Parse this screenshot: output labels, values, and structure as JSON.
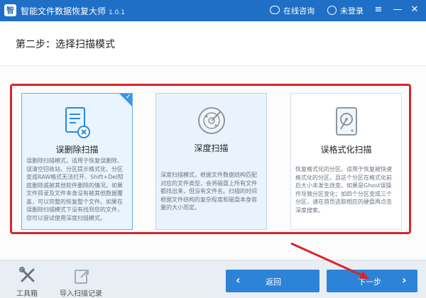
{
  "app": {
    "logo_glyph": "智",
    "title": "智能文件数据恢复大师",
    "version": "1.0.1",
    "online_consult": "在线咨询",
    "login": "未登录",
    "accent_color": "#1e6fc5",
    "highlight_color": "#d7262a"
  },
  "step": {
    "title": "第二步：选择扫描模式"
  },
  "modes": [
    {
      "title": "误删除扫描",
      "icon": "document-delete-icon",
      "selected": true,
      "description": "误删除扫描模式，适用于恢复误删除、误清空回收站、分区提示格式化、分区变成RAW格式无法打开、Shift+Del彻底删除或被其他软件删除的情况。如果文件目录及文件本身没有被其他数据覆盖，可以完整的恢复整个文件。如果在误删除扫描模式下没有找到您的文件，您可以尝试使用深度扫描模式。"
    },
    {
      "title": "深度扫描",
      "icon": "radar-icon",
      "selected": false,
      "description": "深度扫描模式，根据文件数据结构匹配对应的文件类型，会将磁盘上所有文件都找出来，但没有文件名。扫描的时间根据文件结构的复杂程度和磁盘本身容量的大小而定。"
    },
    {
      "title": "误格式化扫描",
      "icon": "hard-disk-icon",
      "selected": false,
      "description": "恢复格式化的分区。适用于恢复被快速格式化的分区，且这个分区在格式化前后大小未发生改变。如果是Ghost误操作导致分区变化；如四个分区变成三个分区，请在首页选取相应的硬盘再点击深度搜索。"
    }
  ],
  "footer": {
    "toolbox": "工具箱",
    "import_record": "导入扫描记录",
    "back": "返回",
    "next": "下一步"
  }
}
